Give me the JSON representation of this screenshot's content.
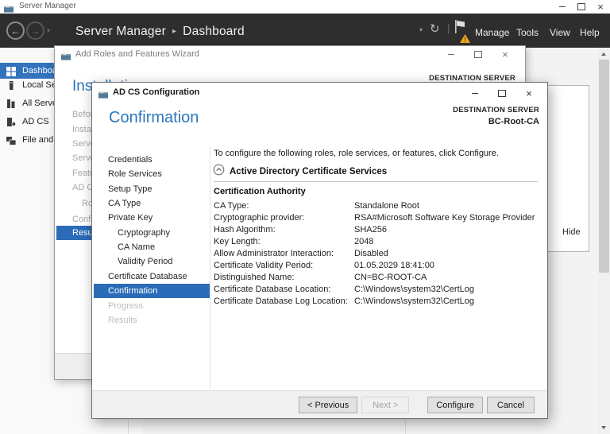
{
  "app": {
    "title": "Server Manager"
  },
  "navbar": {
    "breadcrumb": {
      "root": "Server Manager",
      "separator": "▸",
      "current": "Dashboard"
    },
    "menus": {
      "manage": "Manage",
      "tools": "Tools",
      "view": "View",
      "help": "Help"
    }
  },
  "sidebar": {
    "items": [
      {
        "label": "Dashboard"
      },
      {
        "label": "Local Server"
      },
      {
        "label": "All Servers"
      },
      {
        "label": "AD CS"
      },
      {
        "label": "File and Storage Services"
      }
    ]
  },
  "roles_wizard": {
    "title": "Add Roles and Features Wizard",
    "heading": "Installation progress",
    "destination_label": "DESTINATION SERVER",
    "nav": [
      {
        "label": "Before You Begin"
      },
      {
        "label": "Installation Type"
      },
      {
        "label": "Server Selection"
      },
      {
        "label": "Server Roles"
      },
      {
        "label": "Features"
      },
      {
        "label": "AD CS"
      },
      {
        "label": "Role Services"
      },
      {
        "label": "Confirmation"
      },
      {
        "label": "Results"
      }
    ]
  },
  "notification_panel": {
    "hide_label": "Hide"
  },
  "adcs_dialog": {
    "title": "AD CS Configuration",
    "heading": "Confirmation",
    "destination": {
      "label": "DESTINATION SERVER",
      "server": "BC-Root-CA"
    },
    "intro": "To configure the following roles, role services, or features, click Configure.",
    "section_title": "Active Directory Certificate Services",
    "group_title": "Certification Authority",
    "nav": [
      {
        "label": "Credentials"
      },
      {
        "label": "Role Services"
      },
      {
        "label": "Setup Type"
      },
      {
        "label": "CA Type"
      },
      {
        "label": "Private Key"
      },
      {
        "label": "Cryptography"
      },
      {
        "label": "CA Name"
      },
      {
        "label": "Validity Period"
      },
      {
        "label": "Certificate Database"
      },
      {
        "label": "Confirmation"
      },
      {
        "label": "Progress"
      },
      {
        "label": "Results"
      }
    ],
    "details": [
      {
        "label": "CA Type:",
        "value": "Standalone Root"
      },
      {
        "label": "Cryptographic provider:",
        "value": "RSA#Microsoft Software Key Storage Provider"
      },
      {
        "label": "Hash Algorithm:",
        "value": "SHA256"
      },
      {
        "label": "Key Length:",
        "value": "2048"
      },
      {
        "label": "Allow Administrator Interaction:",
        "value": "Disabled"
      },
      {
        "label": "Certificate Validity Period:",
        "value": "01.05.2029 18:41:00"
      },
      {
        "label": "Distinguished Name:",
        "value": "CN=BC-ROOT-CA"
      },
      {
        "label": "Certificate Database Location:",
        "value": "C:\\Windows\\system32\\CertLog"
      },
      {
        "label": "Certificate Database Log Location:",
        "value": "C:\\Windows\\system32\\CertLog"
      }
    ],
    "buttons": {
      "previous": "< Previous",
      "next": "Next >",
      "configure": "Configure",
      "cancel": "Cancel"
    }
  },
  "colors": {
    "accent_blue": "#2b6cb8",
    "heading_blue": "#2b76bb",
    "warning_yellow": "#f2a71b",
    "topbar_dark": "#2e2e2e"
  }
}
